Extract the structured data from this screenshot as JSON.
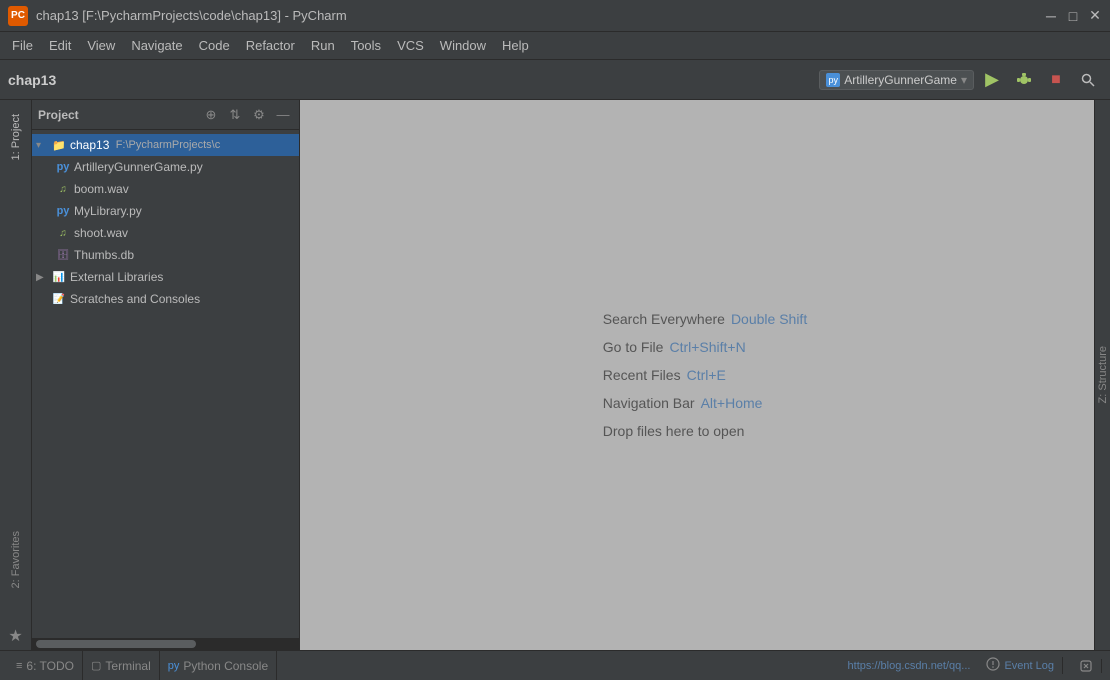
{
  "titlebar": {
    "logo": "PC",
    "title": "chap13 [F:\\PycharmProjects\\code\\chap13] - PyCharm",
    "minimize": "─",
    "maximize": "□",
    "close": "✕"
  },
  "menubar": {
    "items": [
      "File",
      "Edit",
      "View",
      "Navigate",
      "Code",
      "Refactor",
      "Run",
      "Tools",
      "VCS",
      "Window",
      "Help"
    ]
  },
  "toolbar": {
    "project_name": "chap13",
    "run_config": "ArtilleryGunnerGame",
    "run_icon": "▶",
    "debug_icon": "🐛",
    "stop_icon": "■",
    "search_icon": "🔍"
  },
  "project_panel": {
    "title": "Project",
    "header_btns": [
      "⊕",
      "⇅",
      "⚙",
      "—"
    ],
    "tree": [
      {
        "id": "chap13-root",
        "label": "chap13",
        "path": "F:\\PycharmProjects\\c",
        "type": "folder",
        "level": 0,
        "selected": true,
        "expanded": true
      },
      {
        "id": "artillery",
        "label": "ArtilleryGunnerGame.py",
        "type": "py",
        "level": 1
      },
      {
        "id": "boom",
        "label": "boom.wav",
        "type": "wav",
        "level": 1
      },
      {
        "id": "mylibrary",
        "label": "MyLibrary.py",
        "type": "py",
        "level": 1
      },
      {
        "id": "shoot",
        "label": "shoot.wav",
        "type": "wav",
        "level": 1
      },
      {
        "id": "thumbs",
        "label": "Thumbs.db",
        "type": "db",
        "level": 1
      },
      {
        "id": "external-libs",
        "label": "External Libraries",
        "type": "extlib",
        "level": 0,
        "collapsed": true
      },
      {
        "id": "scratches",
        "label": "Scratches and Consoles",
        "type": "scratch",
        "level": 0
      }
    ]
  },
  "editor": {
    "hints": [
      {
        "label": "Search Everywhere",
        "shortcut": "Double Shift"
      },
      {
        "label": "Go to File",
        "shortcut": "Ctrl+Shift+N"
      },
      {
        "label": "Recent Files",
        "shortcut": "Ctrl+E"
      },
      {
        "label": "Navigation Bar",
        "shortcut": "Alt+Home"
      },
      {
        "label": "Drop files here to open",
        "shortcut": ""
      }
    ]
  },
  "left_strip": {
    "tabs": [
      {
        "id": "project",
        "label": "1: Project"
      },
      {
        "id": "favorites",
        "label": "2: Favorites"
      }
    ]
  },
  "right_strip": {
    "tabs": [
      {
        "id": "zstructure",
        "label": "Z: Structure"
      }
    ]
  },
  "statusbar": {
    "todo": "6: TODO",
    "terminal": "Terminal",
    "python_console": "Python Console",
    "event_log": "Event Log",
    "url": "https://blog.csdn.net/qq...",
    "colors": {
      "accent": "#5a7fa8"
    }
  }
}
